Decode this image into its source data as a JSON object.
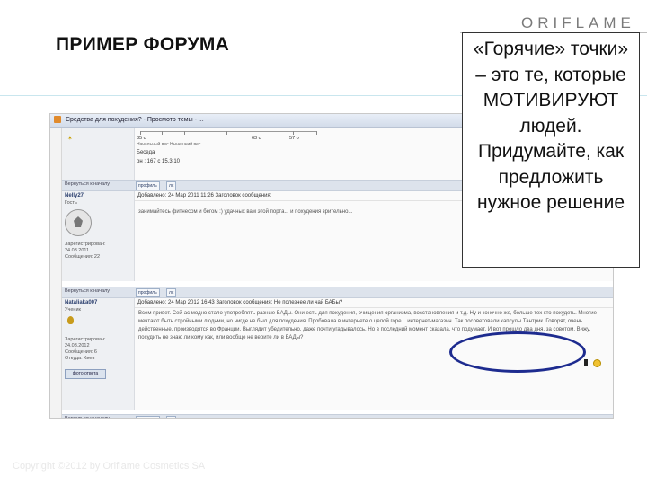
{
  "slide": {
    "title": "ПРИМЕР ФОРУМА",
    "logo": "ORIFLAME",
    "callout": "«Горячие» точки» – это те, которые МОТИВИРУЮТ людей. Придумайте, как предложить нужное решение",
    "copyright": "Copyright ©2012 by Oriflame Cosmetics SA"
  },
  "screenshot": {
    "window_title": "Средства для похудения? - Просмотр темы - ...",
    "chart_labels": [
      "85 σ",
      "63 σ",
      "57 σ"
    ],
    "chart_caption": "Начальный вес  Нынешний вес",
    "topic_word": "Беседа",
    "topic_meta": "рн : 167 с 15.3.10",
    "back_to_top": "Вернуться к началу",
    "buttons": {
      "profile": "профиль",
      "pm": "лс"
    },
    "posts": [
      {
        "user": "Nelly27",
        "rank": "Гость",
        "registered": "Зарегистрирован: 24.03.2011",
        "messages": "Сообщения: 22",
        "header": "Добавлено: 24 Мар 2011 11:26    Заголовок сообщения:",
        "body": "занимайтесь фитнесом и бегом :) удачных вам этой порта... и похудения зрительно..."
      },
      {
        "user": "Nataliаka007",
        "rank": "Ученик",
        "registered": "Зарегистрирован: 24.03.2012",
        "messages": "Сообщения: 6",
        "city": "Откуда: Киев",
        "header": "Добавлено: 24 Мар 2012 16:43    Заголовок сообщения: Не полезнее ли чай БАБы?",
        "body": "Всем привет. Сей-ас модно стало употреблять разные БАДы. Они есть для похудения, очищения организма, восстановления и т.д. Ну и конечно же, больше тех кто похудеть. Многие мечтают быть стройными людьми, но нигде не был для похудения. Пробовала в интернете о целой горе... интернет-магазин. Так посоветовали капсулы Тантрик. Говорят, очень действенные, производятся во Франции. Выглядит убедительно, даже почти угадывалось. Но в последний момент сказала, что подумает. И вот прошло два дня, за советом. Вижу, посудить не знаю ли кому как, или вообще не верите ли в БАДы?",
        "photo_button": "фото ответа"
      }
    ]
  }
}
